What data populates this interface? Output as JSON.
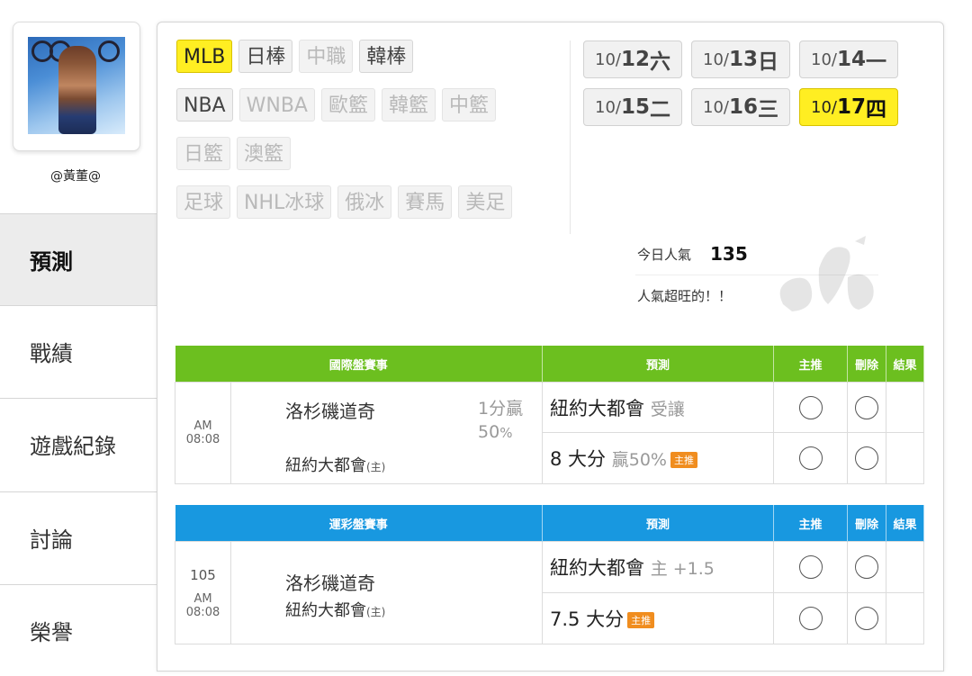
{
  "user": {
    "name": "@黃董@"
  },
  "nav": {
    "items": [
      {
        "label": "預測",
        "active": true
      },
      {
        "label": "戰績"
      },
      {
        "label": "遊戲紀錄"
      },
      {
        "label": "討論"
      },
      {
        "label": "榮譽"
      }
    ]
  },
  "sports": {
    "rows": [
      [
        {
          "label": "MLB",
          "state": "selected"
        },
        {
          "label": "日棒",
          "state": "normal"
        },
        {
          "label": "中職",
          "state": "dim"
        },
        {
          "label": "韓棒",
          "state": "normal"
        }
      ],
      [
        {
          "label": "NBA",
          "state": "normal"
        },
        {
          "label": "WNBA",
          "state": "dim"
        },
        {
          "label": "歐籃",
          "state": "dim"
        },
        {
          "label": "韓籃",
          "state": "dim"
        },
        {
          "label": "中籃",
          "state": "dim"
        }
      ],
      [
        {
          "label": "日籃",
          "state": "dim"
        },
        {
          "label": "澳籃",
          "state": "dim"
        }
      ],
      [
        {
          "label": "足球",
          "state": "dim"
        },
        {
          "label": "NHL冰球",
          "state": "dim"
        },
        {
          "label": "俄冰",
          "state": "dim"
        },
        {
          "label": "賽馬",
          "state": "dim"
        },
        {
          "label": "美足",
          "state": "dim"
        }
      ]
    ]
  },
  "dates": [
    {
      "md": "10/",
      "day": "12",
      "wd": "六"
    },
    {
      "md": "10/",
      "day": "13",
      "wd": "日"
    },
    {
      "md": "10/",
      "day": "14",
      "wd": "一"
    },
    {
      "md": "10/",
      "day": "15",
      "wd": "二"
    },
    {
      "md": "10/",
      "day": "16",
      "wd": "三"
    },
    {
      "md": "10/",
      "day": "17",
      "wd": "四",
      "selected": true
    }
  ],
  "popularity": {
    "label": "今日人氣",
    "value": "135",
    "status": "人氣超旺的！！"
  },
  "international": {
    "headers": {
      "game": "國際盤賽事",
      "predict": "預測",
      "main": "主推",
      "delete": "刪除",
      "result": "結果"
    },
    "time": "AM 08:08",
    "teamA": "洛杉磯道奇",
    "teamB": "紐約大都會",
    "host_mark": "(主)",
    "spread_line": "1分贏",
    "spread_pct": "50",
    "spread_pct_unit": "%",
    "pred1_main": "紐約大都會",
    "pred1_soft": "受讓",
    "pred2_main": "8 大分",
    "pred2_soft": "贏50%",
    "tag": "主推"
  },
  "lottery": {
    "headers": {
      "game": "運彩盤賽事",
      "predict": "預測",
      "main": "主推",
      "delete": "刪除",
      "result": "結果"
    },
    "num": "105",
    "time": "AM 08:08",
    "teamA": "洛杉磯道奇",
    "teamB": "紐約大都會",
    "host_mark": "(主)",
    "pred1_main": "紐約大都會",
    "pred1_soft": "主 +1.5",
    "pred2_main": "7.5 大分",
    "tag": "主推"
  }
}
